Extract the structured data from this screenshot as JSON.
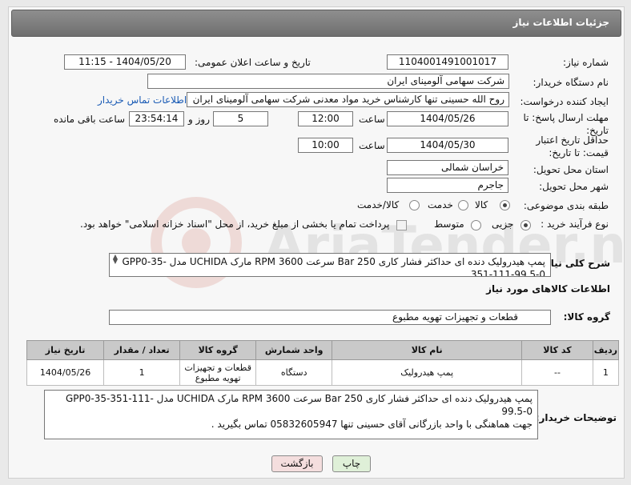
{
  "header": {
    "title": "جزئیات اطلاعات نیاز"
  },
  "fields": {
    "need_number_label": "شماره نیاز:",
    "need_number": "1104001491001017",
    "announce_label": "تاریخ و ساعت اعلان عمومی:",
    "announce_value": "1404/05/20 - 11:15",
    "buyer_label": "نام دستگاه خریدار:",
    "buyer_value": "شرکت سهامی آلومینای ایران",
    "creator_label": "ایجاد کننده درخواست:",
    "creator_value": "روح الله حسینی تنها کارشناس خرید مواد معدنی شرکت سهامی آلومینای ایران",
    "contact_link": "اطلاعات تماس خریدار",
    "deadline_label": "مهلت ارسال پاسخ: تا تاریخ:",
    "deadline_date": "1404/05/26",
    "time_label": "ساعت",
    "deadline_time": "12:00",
    "days_value": "5",
    "days_label": "روز و",
    "remaining_time": "23:54:14",
    "remaining_label": "ساعت باقی مانده",
    "validity_label": "حداقل تاریخ اعتبار قیمت: تا تاریخ:",
    "validity_date": "1404/05/30",
    "validity_time": "10:00",
    "province_label": "استان محل تحویل:",
    "province_value": "خراسان شمالی",
    "city_label": "شهر محل تحویل:",
    "city_value": "جاجرم",
    "category_label": "طبقه بندی موضوعی:",
    "category_options": [
      "کالا",
      "خدمت",
      "کالا/خدمت"
    ],
    "process_label": "نوع فرآیند خرید :",
    "process_options": [
      "جزیی",
      "متوسط"
    ],
    "payment_note": "پرداخت تمام یا بخشی از مبلغ خرید، از محل \"اسناد خزانه اسلامی\" خواهد بود.",
    "summary_label": "شرح کلی نیاز:",
    "summary_text": "پمپ هیدرولیک دنده ای حداکثر فشار کاری 250 Bar سرعت 3600 RPM مارک UCHIDA مدل GPP0-35-351-111-99.5-0",
    "goods_info_label": "اطلاعات کالاهای مورد نیاز",
    "group_label": "گروه کالا:",
    "group_value": "قطعات و تجهیزات تهویه مطبوع"
  },
  "table": {
    "headers": [
      "ردیف",
      "کد کالا",
      "نام کالا",
      "واحد شمارش",
      "گروه کالا",
      "تعداد / مقدار",
      "تاریخ نیاز"
    ],
    "rows": [
      [
        "1",
        "--",
        "پمپ هیدرولیک",
        "دستگاه",
        "قطعات و تجهیزات تهویه مطبوع",
        "1",
        "1404/05/26"
      ]
    ]
  },
  "buyer_notes": {
    "label": "توضیحات خریدار:",
    "line1": "پمپ هیدرولیک دنده ای حداکثر فشار کاری 250 Bar سرعت 3600 RPM مارک UCHIDA مدل GPP0-35-351-111-99.5-0",
    "line2": "جهت هماهنگی با واحد بازرگانی آقای حسینی تنها 05832605947 تماس بگیرید ."
  },
  "buttons": {
    "print": "چاپ",
    "back": "بازگشت"
  },
  "watermark_text": "AriaTender.neT",
  "colors": {
    "title_bg": "#7f7f7f",
    "link": "#1a5bb5",
    "back_bg": "#f4dede",
    "print_bg": "#dff0d8"
  }
}
